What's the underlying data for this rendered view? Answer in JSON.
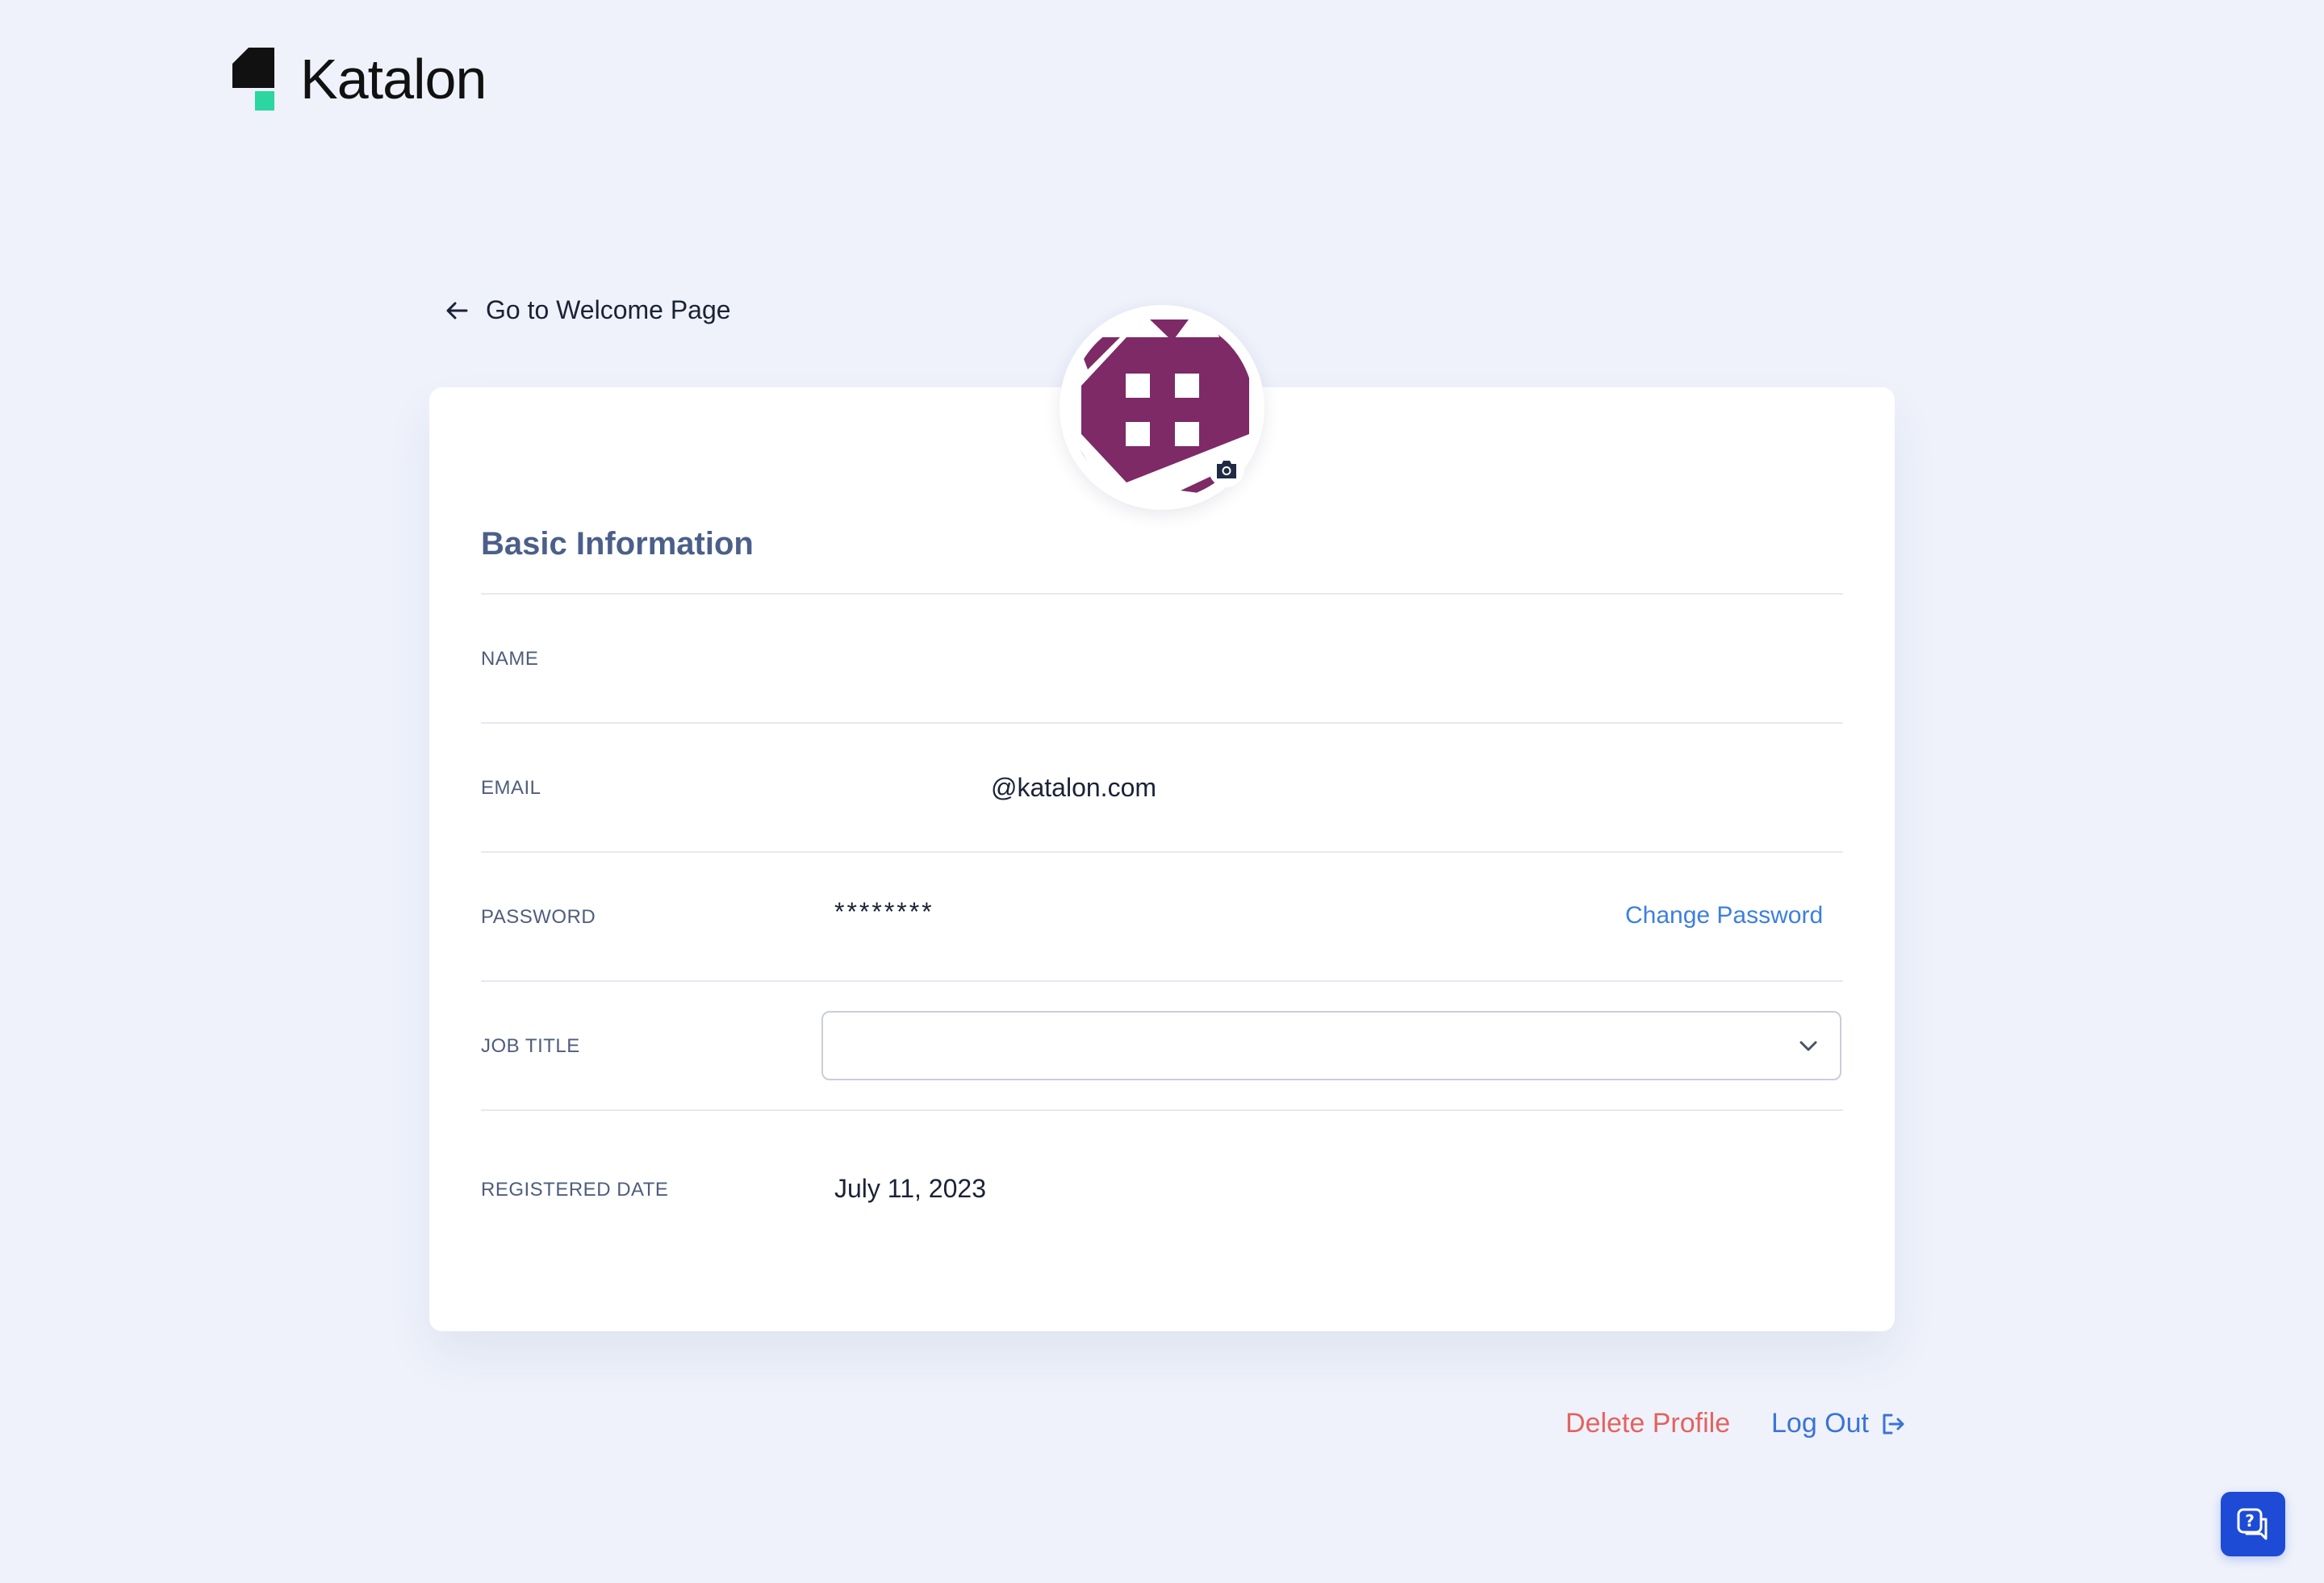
{
  "brand": {
    "name": "Katalon",
    "icon": "katalon-logo-icon"
  },
  "nav": {
    "back_label": "Go to Welcome Page",
    "back_icon": "arrow-left-icon"
  },
  "profile": {
    "avatar_icon": "identicon-avatar",
    "avatar_color": "#7d2a67",
    "camera_icon": "camera-icon",
    "section_title": "Basic Information",
    "fields": {
      "name": {
        "label": "NAME",
        "value": ""
      },
      "email": {
        "label": "EMAIL",
        "value": "@katalon.com"
      },
      "password": {
        "label": "PASSWORD",
        "value": "********",
        "action": "Change Password"
      },
      "job_title": {
        "label": "JOB TITLE",
        "value": "",
        "icon": "chevron-down-icon"
      },
      "registered_date": {
        "label": "REGISTERED DATE",
        "value": "July 11, 2023"
      }
    }
  },
  "actions": {
    "delete_label": "Delete Profile",
    "logout_label": "Log Out",
    "logout_icon": "logout-icon"
  },
  "help": {
    "icon": "help-chat-icon"
  },
  "colors": {
    "background": "#eff2fb",
    "brand_green": "#2bd6a0",
    "link_blue": "#3d7fe0",
    "danger_red": "#e2635f",
    "section_title": "#4b5f8a",
    "help_button": "#1d4bd6"
  }
}
